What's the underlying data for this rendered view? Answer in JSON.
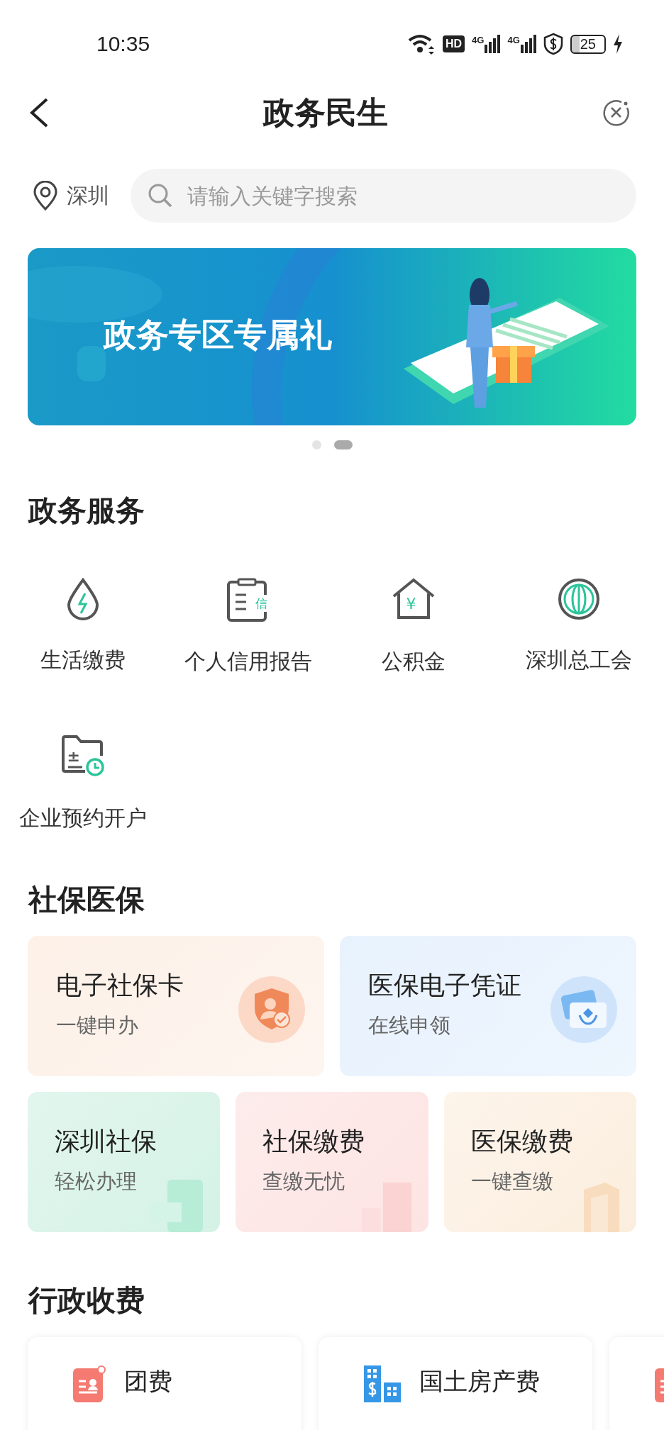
{
  "status_bar": {
    "time": "10:35",
    "hd": "HD",
    "network": [
      "4G",
      "4G"
    ],
    "battery": "25"
  },
  "header": {
    "title": "政务民生"
  },
  "location": "深圳",
  "search": {
    "placeholder": "请输入关键字搜索"
  },
  "banner": {
    "text": "政务专区专属礼",
    "dots": [
      {
        "selected": false
      },
      {
        "selected": true
      }
    ]
  },
  "government_services": {
    "title": "政务服务",
    "items": [
      {
        "label": "生活缴费",
        "kind": "drop"
      },
      {
        "label": "个人信用报告",
        "kind": "clipboard",
        "icon_text": "信"
      },
      {
        "label": "公积金",
        "kind": "house",
        "icon_text": "¥"
      },
      {
        "label": "深圳总工会",
        "kind": "emblem"
      },
      {
        "label": "企业预约开户",
        "kind": "folder",
        "icon_text": "±"
      }
    ]
  },
  "social_insurance": {
    "title": "社保医保",
    "cards": [
      {
        "title": "电子社保卡",
        "subtitle": "一键申办",
        "kind": "shield"
      },
      {
        "title": "医保电子凭证",
        "subtitle": "在线申领",
        "kind": "card"
      },
      {
        "title": "深圳社保",
        "subtitle": "轻松办理",
        "kind": "phone"
      },
      {
        "title": "社保缴费",
        "subtitle": "查缴无忧",
        "kind": "blocks"
      },
      {
        "title": "医保缴费",
        "subtitle": "一键查缴",
        "kind": "stack"
      }
    ]
  },
  "administrative_fees": {
    "title": "行政收费",
    "items": [
      {
        "label": "团费",
        "kind": "id-card"
      },
      {
        "label": "国土房产费",
        "kind": "building"
      },
      {
        "kind": "id-card"
      }
    ]
  }
}
